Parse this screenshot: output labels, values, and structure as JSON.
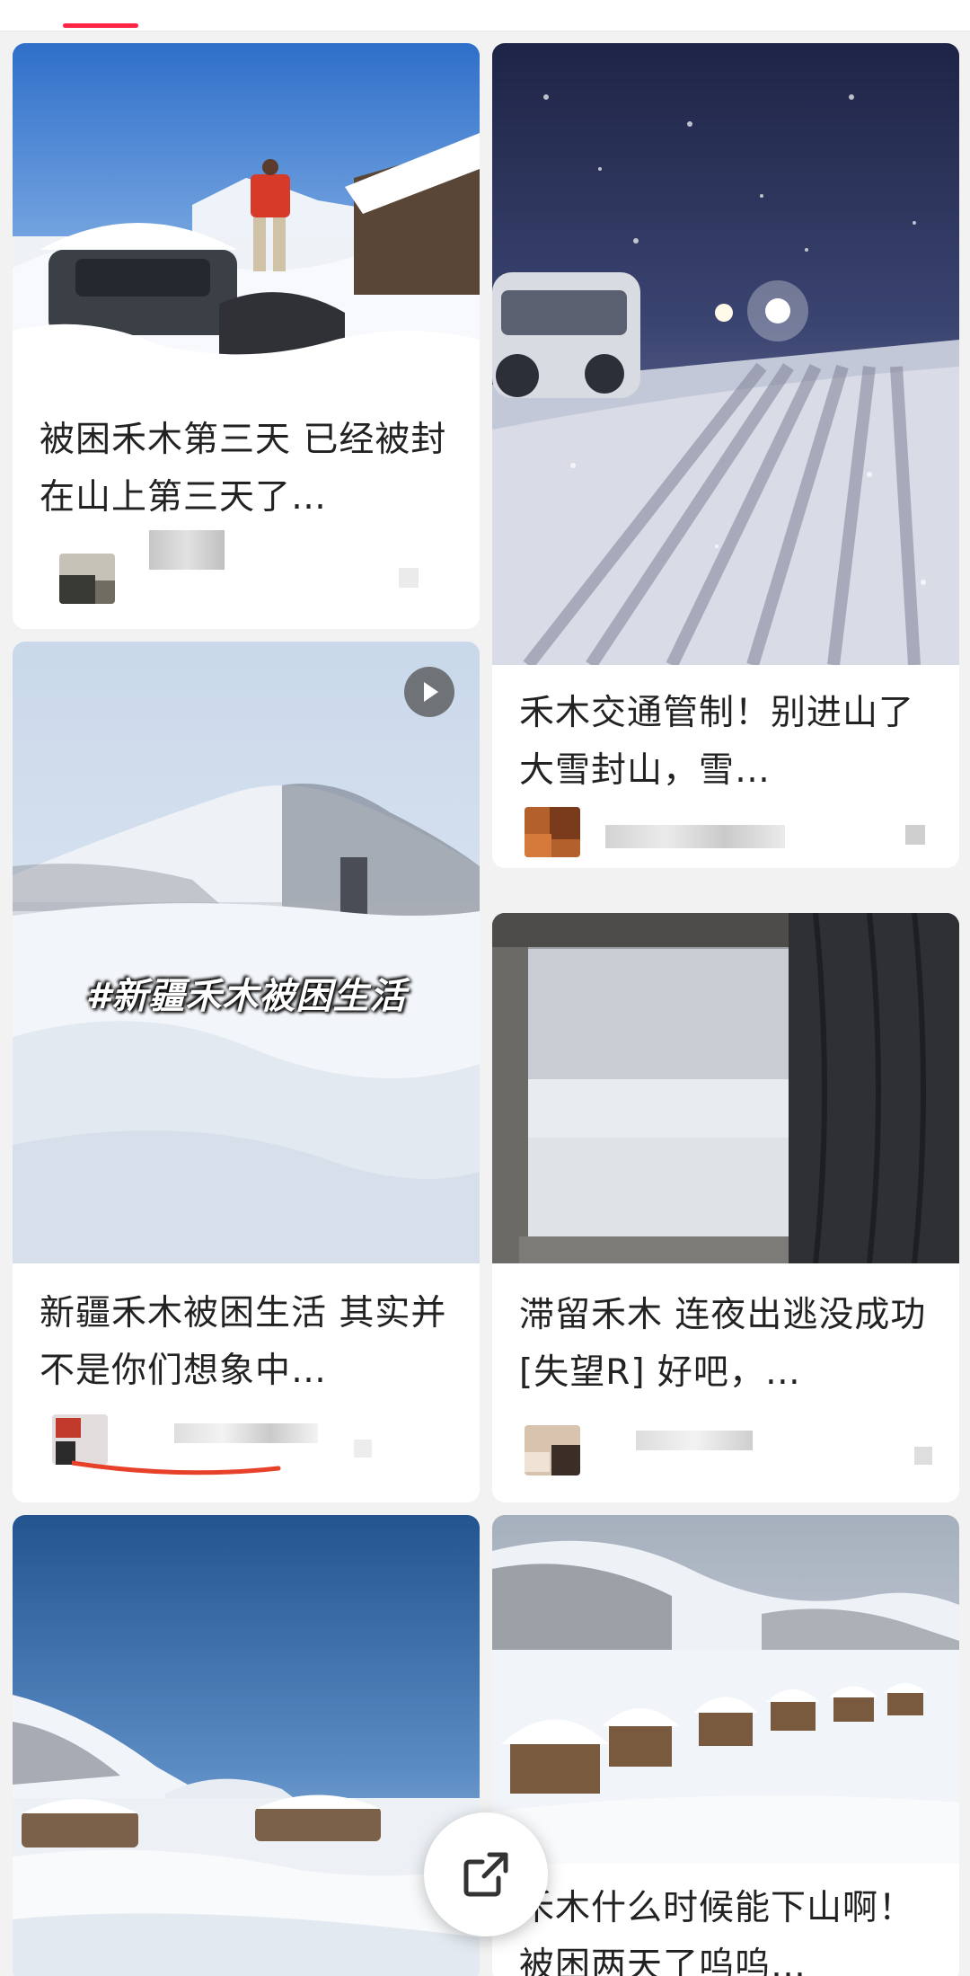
{
  "feed": {
    "cards": [
      {
        "title": "被困禾木第三天 已经被封在山上第三天了…"
      },
      {
        "title": "禾木交通管制！别进山了 大雪封山，雪…"
      },
      {
        "title": "新疆禾木被困生活 其实并不是你们想象中…",
        "overlay_text": "#新疆禾木被困生活",
        "has_video": true
      },
      {
        "title": "滞留禾木 连夜出逃没成功[失望R] 好吧，…"
      },
      {
        "title": ""
      },
      {
        "title": "禾木什么时候能下山啊！被困两天了呜呜…"
      }
    ]
  },
  "share_button": {
    "icon": "share-icon"
  },
  "colors": {
    "accent": "#ff2442",
    "background": "#f2f2f2",
    "card": "#ffffff"
  }
}
